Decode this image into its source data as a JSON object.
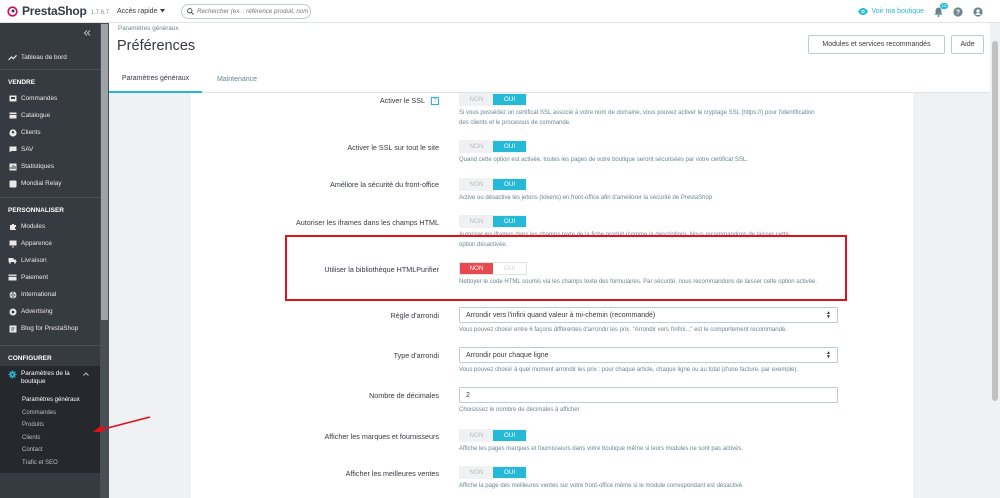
{
  "topbar": {
    "brand": "PrestaShop",
    "version": "1.7.6.7",
    "quick_access": "Accès rapide",
    "search_placeholder": "Rechercher (ex. : référence produit, nom",
    "view_shop": "Voir ma boutique",
    "notifications_count": "12"
  },
  "sidebar": {
    "dashboard": "Tableau de bord",
    "sections": [
      {
        "title": "VENDRE",
        "items": [
          "Commandes",
          "Catalogue",
          "Clients",
          "SAV",
          "Statistiques",
          "Mondial Relay"
        ]
      },
      {
        "title": "PERSONNALISER",
        "items": [
          "Modules",
          "Apparence",
          "Livraison",
          "Paiement",
          "International",
          "Advertising",
          "Blog for PrestaShop"
        ]
      },
      {
        "title": "CONFIGURER",
        "items": []
      }
    ],
    "active_group": "Paramètres de la boutique",
    "active_subitems": [
      "Paramètres généraux",
      "Commandes",
      "Produits",
      "Clients",
      "Contact",
      "Trafic et SEO"
    ]
  },
  "header": {
    "breadcrumb": "Paramètres généraux",
    "title": "Préférences",
    "btn_modules": "Modules et services recommandés",
    "btn_help": "Aide"
  },
  "tabs": [
    "Paramètres généraux",
    "Maintenance"
  ],
  "switch_labels": {
    "no": "NON",
    "yes": "OUI"
  },
  "form": {
    "ssl": {
      "label": "Activer le SSL",
      "help": "Si vous possédez un certificat SSL associé à votre nom de domaine, vous pouvez activer le cryptage SSL (https://) pour l'identification des clients et le processus de commande."
    },
    "ssl_all": {
      "label": "Activer le SSL sur tout le site",
      "help": "Quand cette option est activée, toutes les pages de votre boutique seront sécurisées par votre certificat SSL."
    },
    "front_security": {
      "label": "Améliore la sécurité du front-office",
      "help": "Active ou désactive les jetons (tokens) en front-office afin d'améliorer la sécurité de PrestaShop"
    },
    "iframes": {
      "label": "Autoriser les iframes dans les champs HTML",
      "help": "Autoriser les iframes dans les champs texte de la fiche produit (comme la description). Nous recommandons de laisser cette option désactivée."
    },
    "htmlpurifier": {
      "label": "Utiliser la bibliothèque HTMLPurifier",
      "help": "Nettoyer le code HTML soumis via les champs texte des formulaires. Par sécurité, nous recommandons de laisser cette option activée."
    },
    "rounding_mode": {
      "label": "Règle d'arrondi",
      "value": "Arrondir vers l'infini quand valeur à mi-chemin (recommandé)",
      "help": "Vous pouvez choisir entre 6 façons différentes d'arrondir les prix. \"Arrondir vers l'infini...\" est le comportement recommandé."
    },
    "rounding_type": {
      "label": "Type d'arrondi",
      "value": "Arrondir pour chaque ligne",
      "help": "Vous pouvez choisir à quel moment arrondir les prix : pour chaque article, chaque ligne ou au total (d'une facture, par exemple)."
    },
    "decimals": {
      "label": "Nombre de décimales",
      "value": "2",
      "help": "Choisissez le nombre de décimales à afficher"
    },
    "brands": {
      "label": "Afficher les marques et fournisseurs",
      "help": "Affiche les pages marques et fournisseurs dans votre boutique même si leurs modules ne sont pas activés."
    },
    "best_sales": {
      "label": "Afficher les meilleures ventes",
      "help": "Affiche la page des meilleures ventes sur votre front-office même si le module correspondant est désactivé."
    }
  },
  "colors": {
    "accent": "#25b9d7",
    "sidebar": "#363a41",
    "danger": "#e8494f",
    "highlight": "#e3101e"
  }
}
